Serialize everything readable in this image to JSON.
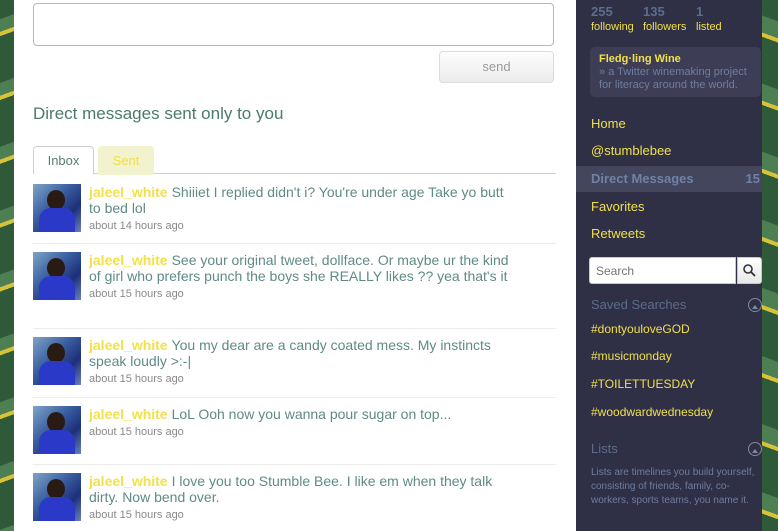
{
  "compose": {
    "send_label": "send"
  },
  "heading": "Direct messages sent only to you",
  "tabs": {
    "inbox": "Inbox",
    "sent": "Sent"
  },
  "messages": [
    {
      "user": "jaleel_white",
      "text": "Shiiiet I replied didn't i? You're under age Take yo butt to bed lol",
      "time": "about 14 hours ago"
    },
    {
      "user": "jaleel_white",
      "text": "See your original tweet, dollface. Or maybe ur the kind of girl who prefers punch the boys she REALLY likes ?? yea that's it",
      "time": "about 15 hours ago"
    },
    {
      "user": "jaleel_white",
      "text": "You my dear are a candy coated mess. My instincts speak loudly >:-|",
      "time": "about 15 hours ago"
    },
    {
      "user": "jaleel_white",
      "text": "LoL Ooh now you wanna pour sugar on top...",
      "time": "about 15 hours ago"
    },
    {
      "user": "jaleel_white",
      "text": "I love you too Stumble Bee. I like em when they talk dirty. Now bend over.",
      "time": "about 15 hours ago"
    }
  ],
  "sidebar": {
    "stats": [
      {
        "num": "255",
        "label": "following"
      },
      {
        "num": "135",
        "label": "followers"
      },
      {
        "num": "1",
        "label": "listed"
      }
    ],
    "promo": {
      "title": "Fledg·ling Wine",
      "desc": "a Twitter winemaking project for literacy around the world."
    },
    "nav": [
      {
        "label": "Home"
      },
      {
        "label": "@stumblebee"
      },
      {
        "label": "Direct Messages",
        "count": "15"
      },
      {
        "label": "Favorites"
      },
      {
        "label": "Retweets"
      }
    ],
    "search_placeholder": "Search",
    "saved_searches_title": "Saved Searches",
    "saved_searches": [
      "#dontyouloveGOD",
      "#musicmonday",
      "#TOILETTUESDAY",
      "#woodwardwednesday"
    ],
    "lists_title": "Lists",
    "lists_desc": "Lists are timelines you build yourself, consisting of friends, family, co-workers, sports teams, you name it."
  },
  "colors": {
    "accent_yellow": "#f0e04a",
    "sidebar_bg": "#2f2f45",
    "heading_teal": "#4b7b69"
  }
}
